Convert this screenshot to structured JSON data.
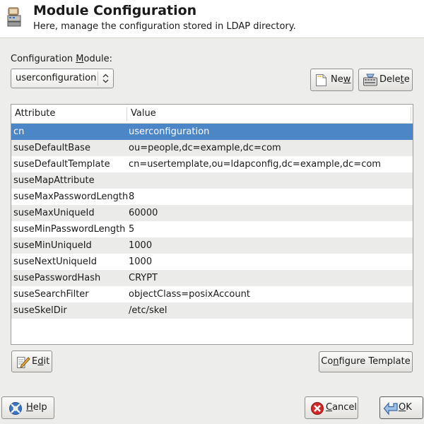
{
  "header": {
    "title": "Module Configuration",
    "subtitle": "Here, manage the configuration stored in LDAP directory."
  },
  "module": {
    "label_pre": "Configuration ",
    "label_u": "M",
    "label_post": "odule:",
    "selected": "userconfiguration"
  },
  "buttons": {
    "new_pre": "Ne",
    "new_u": "w",
    "new_post": "",
    "delete_pre": "Dele",
    "delete_u": "t",
    "delete_post": "e",
    "edit_pre": "E",
    "edit_u": "d",
    "edit_post": "it",
    "configure_pre": "Co",
    "configure_u": "n",
    "configure_post": "figure Template",
    "help_pre": "",
    "help_u": "H",
    "help_post": "elp",
    "cancel_pre": "",
    "cancel_u": "C",
    "cancel_post": "ancel",
    "ok_pre": "",
    "ok_u": "O",
    "ok_post": "K"
  },
  "table": {
    "columns": [
      "Attribute",
      "Value"
    ],
    "rows": [
      {
        "attribute": "cn",
        "value": "userconfiguration",
        "selected": true
      },
      {
        "attribute": "suseDefaultBase",
        "value": "ou=people,dc=example,dc=com"
      },
      {
        "attribute": "suseDefaultTemplate",
        "value": "cn=usertemplate,ou=ldapconfig,dc=example,dc=com"
      },
      {
        "attribute": "suseMapAttribute",
        "value": ""
      },
      {
        "attribute": "suseMaxPasswordLength",
        "value": "8"
      },
      {
        "attribute": "suseMaxUniqueId",
        "value": "60000"
      },
      {
        "attribute": "suseMinPasswordLength",
        "value": "5"
      },
      {
        "attribute": "suseMinUniqueId",
        "value": "1000"
      },
      {
        "attribute": "suseNextUniqueId",
        "value": "1000"
      },
      {
        "attribute": "susePasswordHash",
        "value": "CRYPT"
      },
      {
        "attribute": "suseSearchFilter",
        "value": "objectClass=posixAccount"
      },
      {
        "attribute": "suseSkelDir",
        "value": "/etc/skel"
      }
    ]
  },
  "colors": {
    "selection": "#4c86c6",
    "row_alt": "#ebebea",
    "window_bg": "#ededeb"
  },
  "icons": {
    "header": "ldap-module-icon",
    "new": "new-document-icon",
    "delete": "delete-keyboard-icon",
    "edit": "edit-pencil-icon",
    "help": "help-icon",
    "cancel": "cancel-icon",
    "ok": "ok-arrow-icon"
  }
}
